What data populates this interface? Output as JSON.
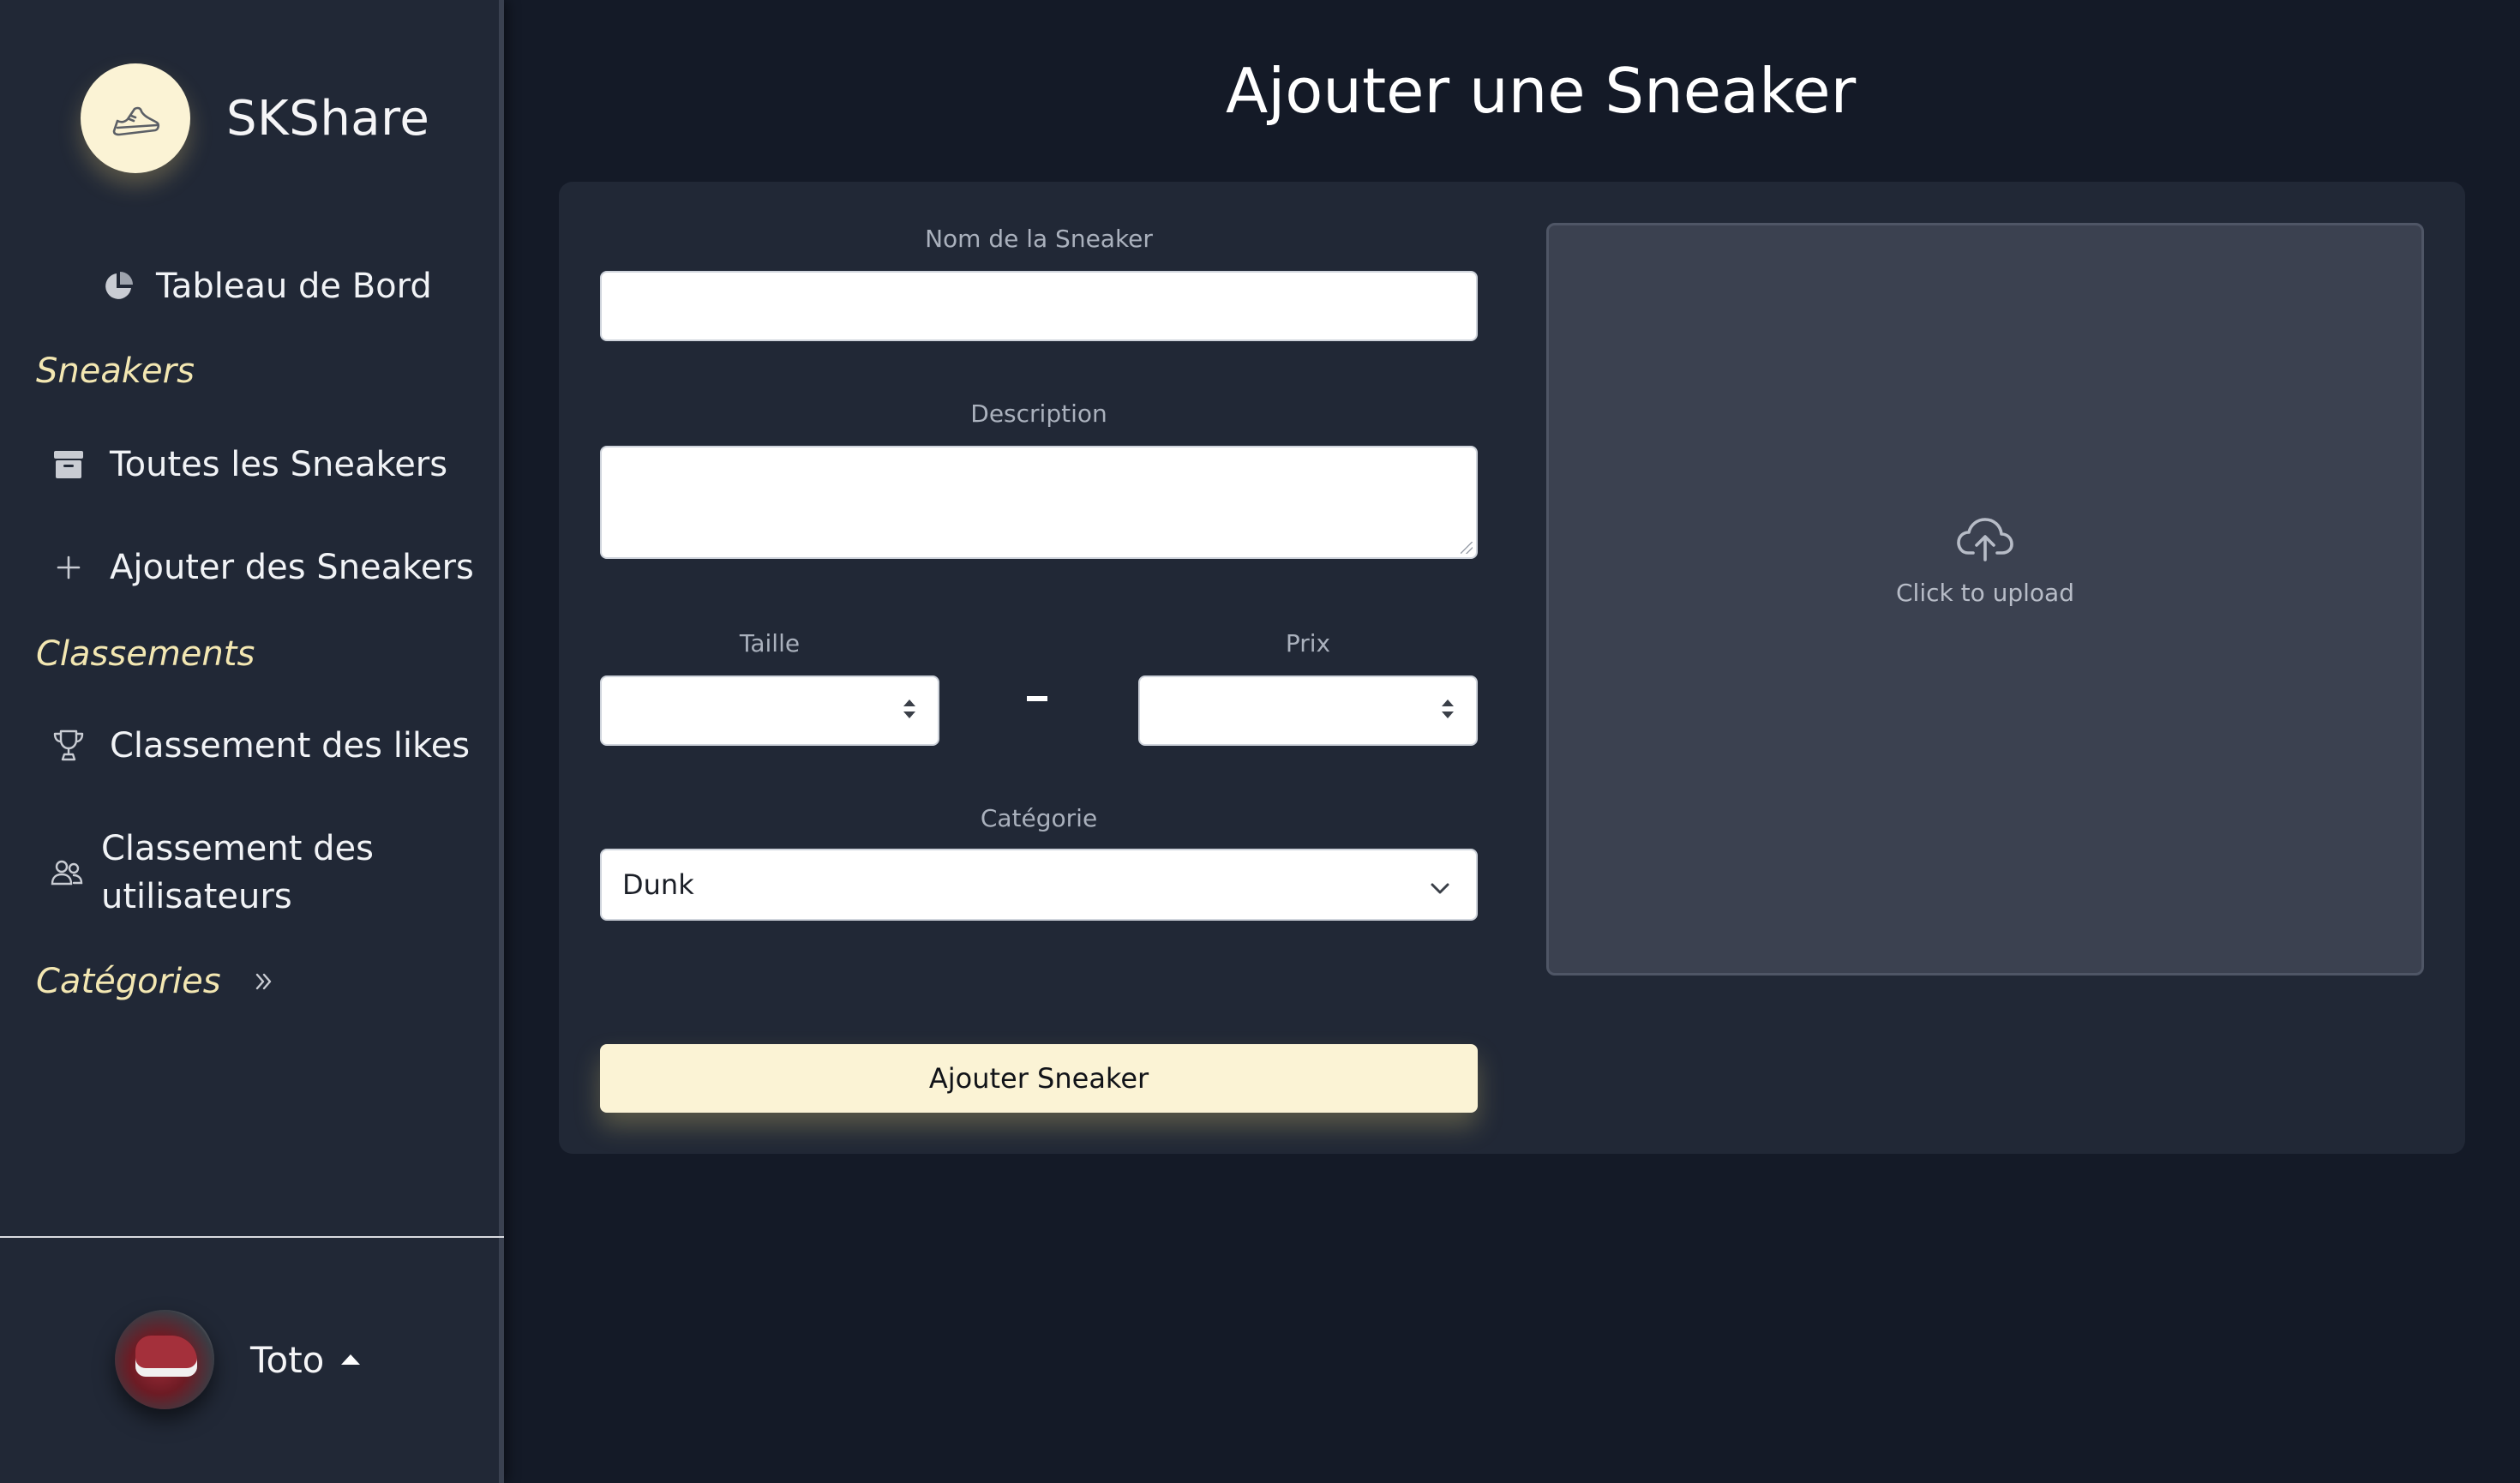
{
  "app": {
    "brand_name": "SKShare",
    "brand_icon": "sneaker-icon"
  },
  "sidebar": {
    "dashboard": {
      "label": "Tableau de Bord",
      "icon": "pie-chart-icon"
    },
    "sections": [
      {
        "title": "Sneakers",
        "items": [
          {
            "label": "Toutes les Sneakers",
            "icon": "archive-box-icon"
          },
          {
            "label": "Ajouter des Sneakers",
            "icon": "plus-icon"
          }
        ]
      },
      {
        "title": "Classements",
        "items": [
          {
            "label": "Classement des likes",
            "icon": "trophy-icon"
          },
          {
            "label": "Classement des utilisateurs",
            "icon": "users-icon"
          }
        ]
      },
      {
        "title": "Catégories",
        "expand_icon": "chevron-double-right-icon"
      }
    ],
    "user": {
      "name": "Toto",
      "caret_icon": "caret-up-icon"
    }
  },
  "main": {
    "title": "Ajouter une Sneaker",
    "form": {
      "name_label": "Nom de la Sneaker",
      "name_value": "",
      "description_label": "Description",
      "description_value": "",
      "size_label": "Taille",
      "size_value": "",
      "separator": "-",
      "price_label": "Prix",
      "price_value": "",
      "category_label": "Catégorie",
      "category_selected": "Dunk",
      "submit_label": "Ajouter Sneaker"
    },
    "upload": {
      "icon": "cloud-upload-icon",
      "text": "Click to upload"
    }
  },
  "colors": {
    "background": "#141a27",
    "sidebar": "#212836",
    "card": "#212836",
    "accent": "#fbf3d5",
    "section_title": "#f3e7b2",
    "upload_area": "#3b4150"
  }
}
